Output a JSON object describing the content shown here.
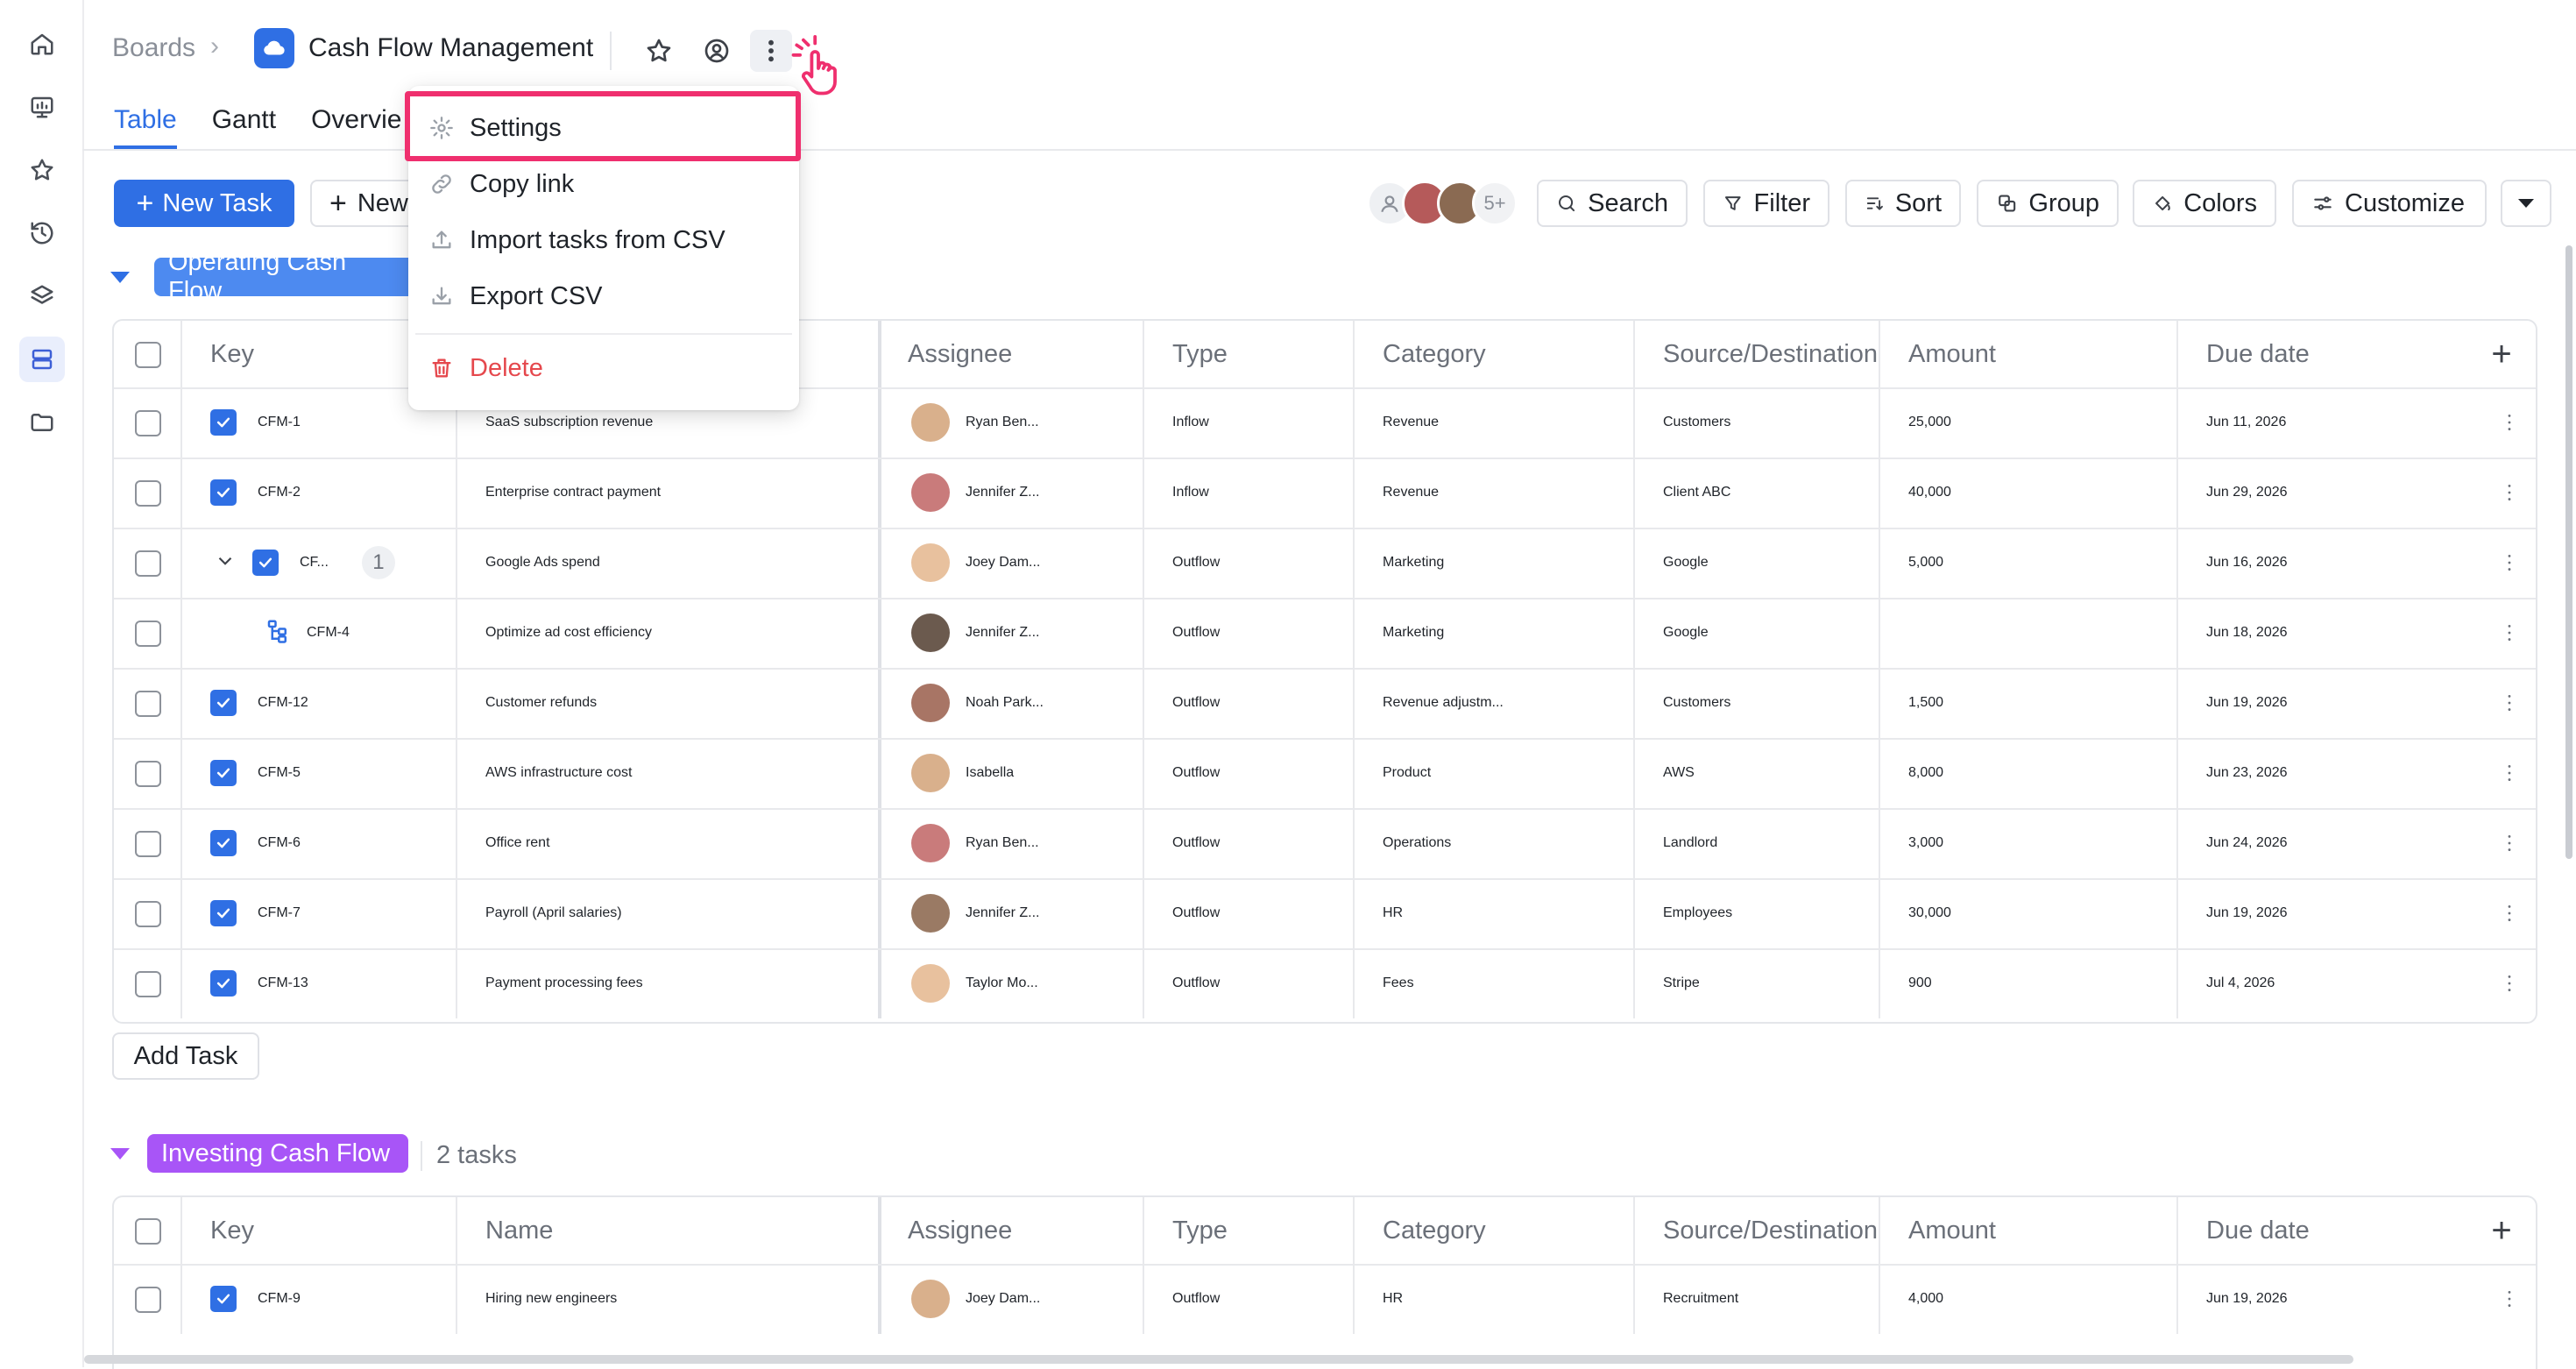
{
  "rail": {
    "items": [
      "home-icon",
      "dashboard-icon",
      "star-icon",
      "history-icon",
      "layers-icon",
      "boards-icon",
      "folder-icon"
    ]
  },
  "header": {
    "breadcrumb": "Boards",
    "board_title": "Cash Flow Management"
  },
  "tabs": [
    "Table",
    "Gantt",
    "Overvie"
  ],
  "toolbar": {
    "new_task": "New Task",
    "new_other": "New",
    "avatars_more": "5+",
    "search": "Search",
    "filter": "Filter",
    "sort": "Sort",
    "group": "Group",
    "colors": "Colors",
    "customize": "Customize"
  },
  "menu": {
    "settings": "Settings",
    "copy_link": "Copy link",
    "import_csv": "Import tasks from CSV",
    "export_csv": "Export CSV",
    "delete": "Delete"
  },
  "columns": {
    "key": "Key",
    "name": "Name",
    "assignee": "Assignee",
    "type": "Type",
    "category": "Category",
    "source": "Source/Destination",
    "amount": "Amount",
    "due": "Due date"
  },
  "groups": [
    {
      "label": "Operating Cash Flow",
      "color": "#4d8af0",
      "rows": [
        {
          "key": "CFM-1",
          "name": "SaaS subscription revenue",
          "assignee": "Ryan Ben...",
          "type": "Inflow",
          "category": "Revenue",
          "source": "Customers",
          "amount": "25,000",
          "due": "Jun 11, 2026"
        },
        {
          "key": "CFM-2",
          "name": "Enterprise contract payment",
          "assignee": "Jennifer Z...",
          "type": "Inflow",
          "category": "Revenue",
          "source": "Client ABC",
          "amount": "40,000",
          "due": "Jun 29, 2026"
        },
        {
          "key": "CF...",
          "subcount": "1",
          "name": "Google Ads spend",
          "assignee": "Joey Dam...",
          "type": "Outflow",
          "category": "Marketing",
          "source": "Google",
          "amount": "5,000",
          "due": "Jun 16, 2026"
        },
        {
          "key": "CFM-4",
          "name": "Optimize ad cost efficiency",
          "assignee": "Jennifer Z...",
          "type": "Outflow",
          "category": "Marketing",
          "source": "Google",
          "amount": "",
          "due": "Jun 18, 2026"
        },
        {
          "key": "CFM-12",
          "name": "Customer refunds",
          "assignee": "Noah Park...",
          "type": "Outflow",
          "category": "Revenue adjustm...",
          "source": "Customers",
          "amount": "1,500",
          "due": "Jun 19, 2026"
        },
        {
          "key": "CFM-5",
          "name": "AWS infrastructure cost",
          "assignee": "Isabella",
          "type": "Outflow",
          "category": "Product",
          "source": "AWS",
          "amount": "8,000",
          "due": "Jun 23, 2026"
        },
        {
          "key": "CFM-6",
          "name": "Office rent",
          "assignee": "Ryan Ben...",
          "type": "Outflow",
          "category": "Operations",
          "source": "Landlord",
          "amount": "3,000",
          "due": "Jun 24, 2026"
        },
        {
          "key": "CFM-7",
          "name": "Payroll (April salaries)",
          "assignee": "Jennifer Z...",
          "type": "Outflow",
          "category": "HR",
          "source": "Employees",
          "amount": "30,000",
          "due": "Jun 19, 2026"
        },
        {
          "key": "CFM-13",
          "name": "Payment processing fees",
          "assignee": "Taylor Mo...",
          "type": "Outflow",
          "category": "Fees",
          "source": "Stripe",
          "amount": "900",
          "due": "Jul 4, 2026"
        }
      ],
      "add_task": "Add Task"
    },
    {
      "label": "Investing Cash Flow",
      "color": "#a855f7",
      "count": "2 tasks",
      "rows": [
        {
          "key": "CFM-9",
          "name": "Hiring new engineers",
          "assignee": "Joey Dam...",
          "type": "Outflow",
          "category": "HR",
          "source": "Recruitment",
          "amount": "4,000",
          "due": "Jun 19, 2026"
        }
      ]
    }
  ],
  "colors": {
    "accent": "#2f6fe4",
    "highlight": "#ef2f6e",
    "delete": "#e5484d"
  }
}
